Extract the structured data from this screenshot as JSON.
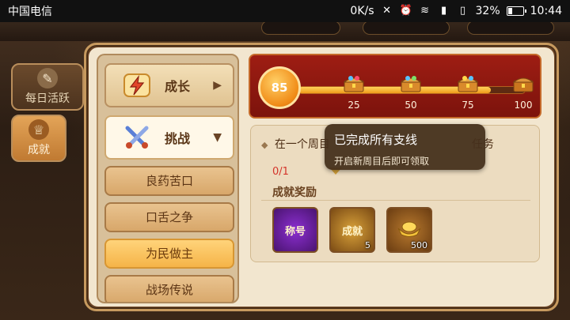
{
  "status_bar": {
    "carrier": "中国电信",
    "speed": "0K/s",
    "battery": "32%",
    "battery_level": 0.32,
    "time": "10:44"
  },
  "side_tabs": [
    {
      "label": "每日活跃",
      "icon": "scroll-icon",
      "active": false
    },
    {
      "label": "成就",
      "icon": "trophy-icon",
      "active": true
    }
  ],
  "categories": {
    "growth": {
      "label": "成长",
      "icon": "lightning-icon"
    },
    "challenge": {
      "label": "挑战",
      "icon": "crossed-swords-icon"
    },
    "sub_items": [
      {
        "label": "良药苦口",
        "active": false
      },
      {
        "label": "口舌之争",
        "active": false
      },
      {
        "label": "为民做主",
        "active": true
      },
      {
        "label": "战场传说",
        "active": false
      }
    ]
  },
  "progress": {
    "current": 85,
    "max": 100,
    "milestones": [
      {
        "value": "25"
      },
      {
        "value": "50"
      },
      {
        "value": "75"
      },
      {
        "value": "100"
      }
    ]
  },
  "task": {
    "title_start": "在一个周目",
    "title_end": "任务",
    "progress": "0/1",
    "reward_label": "成就奖励",
    "rewards": [
      {
        "icon": "title-scroll-icon",
        "glyph": "称号",
        "count": ""
      },
      {
        "icon": "achievement-badge-icon",
        "glyph": "成就",
        "count": "5"
      },
      {
        "icon": "gold-ingot-icon",
        "glyph": "",
        "count": "500"
      }
    ]
  },
  "tooltip": {
    "line1": "已完成所有支线",
    "line2": "开启新周目后即可领取"
  }
}
